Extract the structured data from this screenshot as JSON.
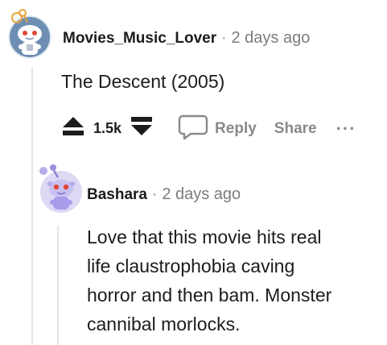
{
  "comment": {
    "username": "Movies_Music_Lover",
    "separator": "·",
    "time": "2 days ago",
    "text": "The Descent (2005)",
    "score": "1.5k",
    "reply_label": "Reply",
    "share_label": "Share",
    "more_label": "···"
  },
  "reply": {
    "username": "Bashara",
    "separator": "·",
    "time": "2 days ago",
    "lines": [
      "Love that this movie hits real",
      "life claustrophobia caving",
      "horror and then bam. Monster",
      "cannibal morlocks."
    ]
  },
  "colors": {
    "upvote": "#1c1c1c",
    "muted": "#878a8c",
    "thread": "#e6e6e6",
    "avatar_top_bg": "#6e8fb3",
    "avatar_reply_bg": "#dcd9f5"
  }
}
